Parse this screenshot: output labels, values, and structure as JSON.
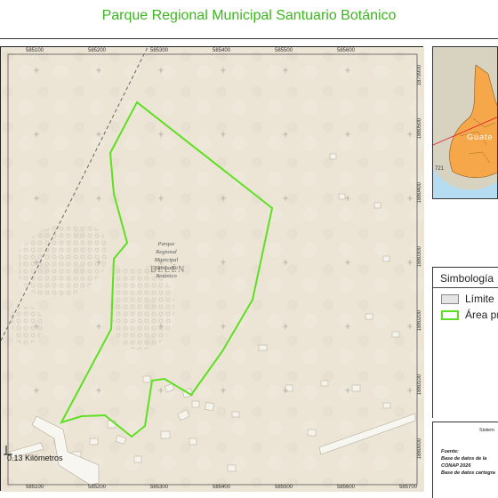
{
  "title": "Parque Regional Municipal Santuario Botánico",
  "map": {
    "x_labels": [
      "585100",
      "585200",
      "585300",
      "585400",
      "585500",
      "585600"
    ],
    "bottom_x_labels": [
      "585100",
      "585200",
      "585300",
      "585400",
      "585500",
      "585600",
      "585700"
    ],
    "y_labels": [
      "1880500",
      "1880400",
      "1880300",
      "1880200",
      "1880100",
      "1880000",
      "1879900"
    ],
    "park_label_lines": [
      "Parque",
      "Regional",
      "Municipal",
      "Santuario",
      "Botánico"
    ],
    "town_label": "BELÉN",
    "boundary_color": "#5ee022",
    "background_color": "#ece5d6"
  },
  "scale": {
    "label": "0.13 Kilómetros"
  },
  "inset": {
    "label": "Guate",
    "number": "721",
    "land_color": "#f5a74a",
    "water_color": "#b6dcf1"
  },
  "legend": {
    "title": "Simbología",
    "items": [
      {
        "label": "Límite",
        "fill": "#e4e4e4",
        "stroke": "#888888"
      },
      {
        "label": "Área pr",
        "fill": "#ffffff",
        "stroke": "#5ee022"
      }
    ]
  },
  "info": {
    "heading": "Sistem",
    "source_label": "Fuente:",
    "lines": [
      "Base de datos de la",
      "CONAP 2026",
      "Base de datos cartogra"
    ]
  }
}
